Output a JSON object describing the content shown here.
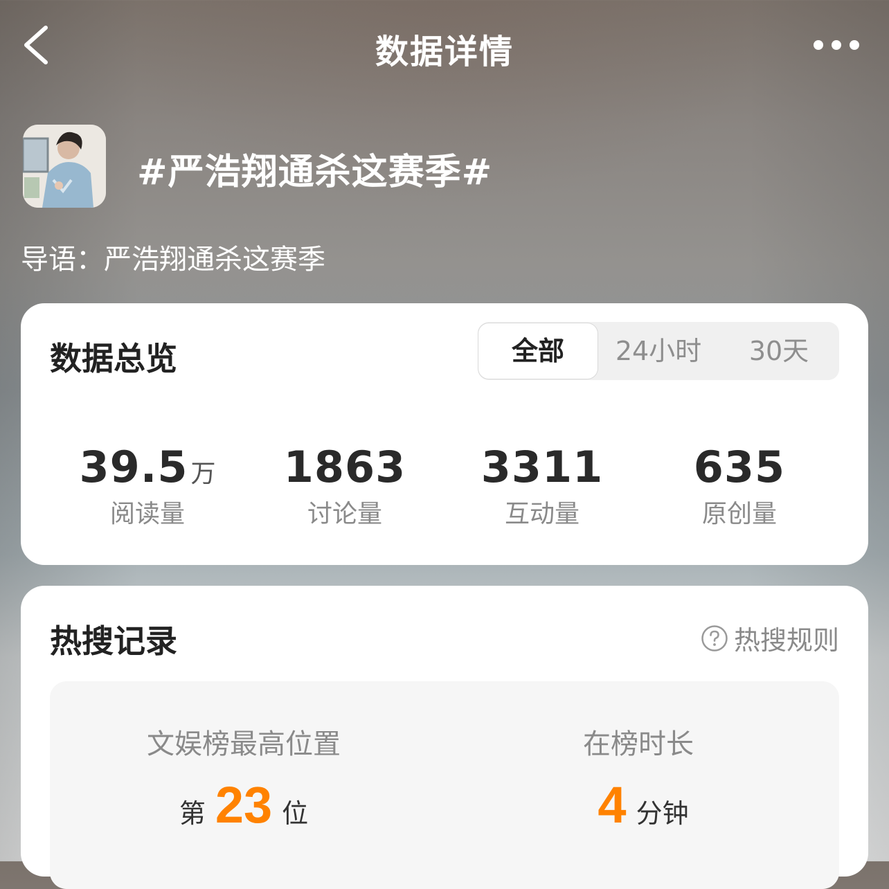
{
  "nav": {
    "title": "数据详情",
    "back_icon": "chevron-left-icon",
    "more_icon": "more-dots-icon"
  },
  "topic": {
    "title": "#严浩翔通杀这赛季#",
    "intro": "导语：严浩翔通杀这赛季"
  },
  "overview": {
    "title": "数据总览",
    "tabs": [
      {
        "label": "全部",
        "active": true
      },
      {
        "label": "24小时",
        "active": false
      },
      {
        "label": "30天",
        "active": false
      }
    ],
    "stats": [
      {
        "value": "39.5",
        "unit": "万",
        "label": "阅读量"
      },
      {
        "value": "1863",
        "unit": "",
        "label": "讨论量"
      },
      {
        "value": "3311",
        "unit": "",
        "label": "互动量"
      },
      {
        "value": "635",
        "unit": "",
        "label": "原创量"
      }
    ]
  },
  "hot": {
    "title": "热搜记录",
    "rule_label": "热搜规则",
    "rule_icon": "question-circle-icon",
    "highest": {
      "label": "文娱榜最高位置",
      "prefix": "第",
      "value": "23",
      "suffix": "位"
    },
    "duration": {
      "label": "在榜时长",
      "value": "4",
      "suffix": "分钟"
    }
  },
  "colors": {
    "accent": "#ff8200",
    "card": "#ffffff",
    "muted_text": "#8a8a8a"
  }
}
